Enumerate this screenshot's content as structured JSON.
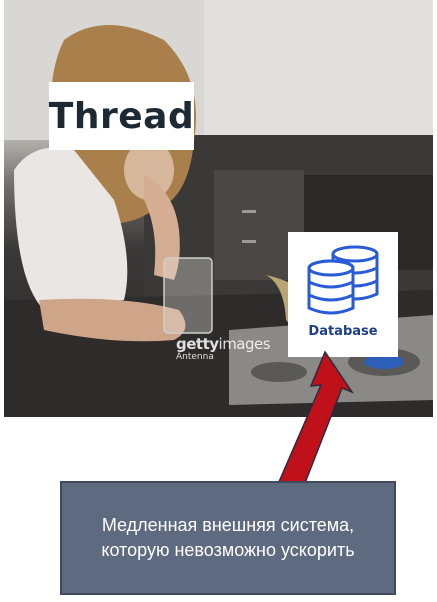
{
  "meme": {
    "thread_label": "Thread",
    "database_label": "Database",
    "watermark": {
      "brand_bold": "getty",
      "brand_light": "images",
      "credit": "Antenna"
    },
    "caption_line1": "Медленная внешняя система,",
    "caption_line2": "которую невозможно ускорить"
  },
  "colors": {
    "callout_bg": "#5d6a80",
    "arrow": "#c0101a",
    "database_icon": "#2a5bd7"
  }
}
